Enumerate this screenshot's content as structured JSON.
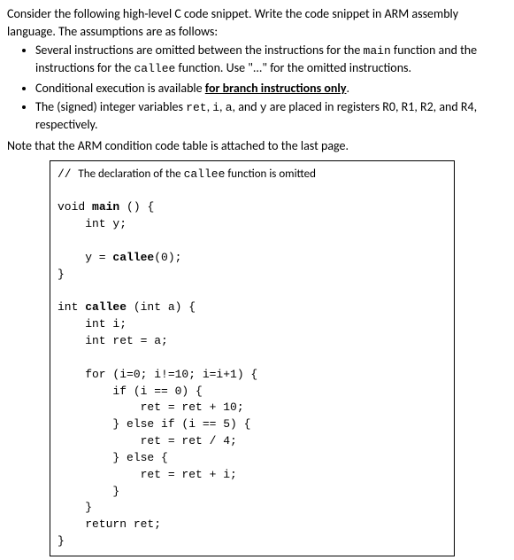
{
  "intro": {
    "para1_pre": "Consider the following high-level C code snippet. Write the code snippet in ARM assembly language. The assumptions are as follows:"
  },
  "bullets": {
    "b1_a": "Several instructions are omitted between the instructions for the ",
    "b1_main": "main",
    "b1_b": " function and the instructions for the ",
    "b1_callee": "callee",
    "b1_c": " function. Use \"...\" for the omitted instructions.",
    "b2_a": "Conditional execution is available ",
    "b2_bold": "for branch instructions only",
    "b2_b": ".",
    "b3_a": "The (signed) integer variables ",
    "b3_ret": "ret",
    "b3_b": ", ",
    "b3_i": "i",
    "b3_c": ", ",
    "b3_aa": "a",
    "b3_d": ", and ",
    "b3_y": "y",
    "b3_e": " are placed in registers R0, R1, R2, and R4, respectively."
  },
  "note": "Note that the ARM condition code table is attached to the last page.",
  "code": {
    "l01a": "// ",
    "l01b": "The declaration of the ",
    "l01c": "callee",
    "l01d": " function is omitted",
    "l02": "",
    "l03a": "void ",
    "l03b": "main",
    "l03c": " () {",
    "l04": "    int y;",
    "l05": "",
    "l06a": "    y = ",
    "l06b": "callee",
    "l06c": "(0);",
    "l07": "}",
    "l08": "",
    "l09a": "int ",
    "l09b": "callee",
    "l09c": " (int a) {",
    "l10": "    int i;",
    "l11": "    int ret = a;",
    "l12": "",
    "l13": "    for (i=0; i!=10; i=i+1) {",
    "l14": "        if (i == 0) {",
    "l15": "            ret = ret + 10;",
    "l16": "        } else if (i == 5) {",
    "l17": "            ret = ret / 4;",
    "l18": "        } else {",
    "l19": "            ret = ret + i;",
    "l20": "        }",
    "l21": "    }",
    "l22": "    return ret;",
    "l23": "}"
  }
}
